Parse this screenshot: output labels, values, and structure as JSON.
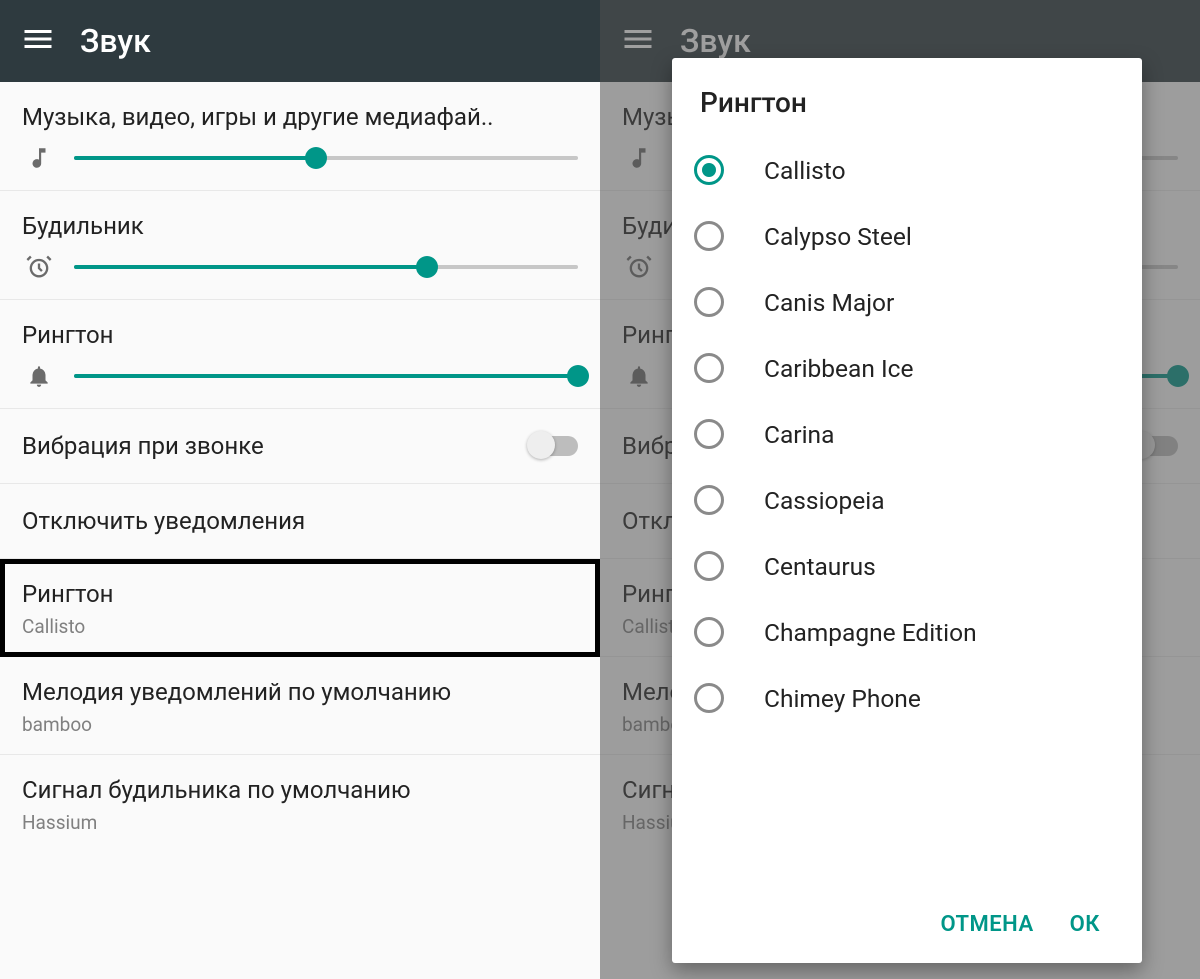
{
  "header": {
    "title": "Звук"
  },
  "colors": {
    "accent": "#009688"
  },
  "sliders": {
    "media": {
      "label": "Музыка, видео, игры и другие медиафай..",
      "pct": 48,
      "icon": "music-note-icon"
    },
    "alarm": {
      "label": "Будильник",
      "pct": 70,
      "icon": "alarm-clock-icon"
    },
    "ringtone": {
      "label": "Рингтон",
      "pct": 100,
      "icon": "bell-icon"
    }
  },
  "rows": {
    "vibrate": {
      "label": "Вибрация при звонке",
      "state": "off"
    },
    "dnd": {
      "label": "Отключить уведомления"
    },
    "ringtone": {
      "label": "Рингтон",
      "value": "Callisto"
    },
    "notification": {
      "label": "Мелодия уведомлений по умолчанию",
      "value": "bamboo"
    },
    "alarm_sound": {
      "label": "Сигнал будильника по умолчанию",
      "value": "Hassium"
    }
  },
  "dialog": {
    "title": "Рингтон",
    "selected_index": 0,
    "items": [
      "Callisto",
      "Calypso Steel",
      "Canis Major",
      "Caribbean Ice",
      "Carina",
      "Cassiopeia",
      "Centaurus",
      "Champagne Edition",
      "Chimey Phone"
    ],
    "actions": {
      "cancel": "ОТМЕНА",
      "ok": "ОК"
    }
  }
}
